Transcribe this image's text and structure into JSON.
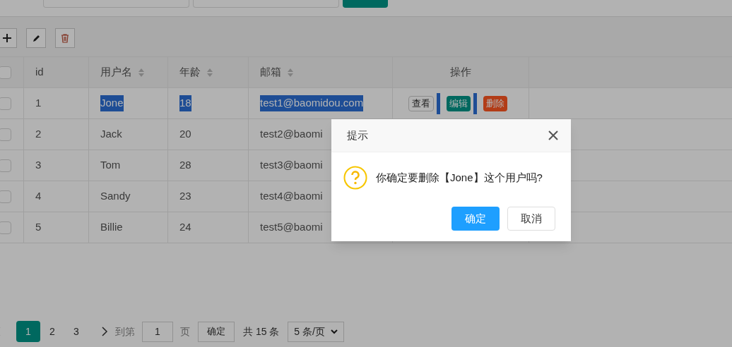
{
  "toolbar": {
    "buttons": [
      {
        "kind": "add"
      },
      {
        "kind": "edit"
      },
      {
        "kind": "delete"
      }
    ]
  },
  "table": {
    "all_checked": false,
    "columns": [
      {
        "label": "id",
        "sortable": false
      },
      {
        "label": "用户名",
        "sortable": true
      },
      {
        "label": "年龄",
        "sortable": true
      },
      {
        "label": "邮箱",
        "sortable": true
      },
      {
        "label": "操作",
        "sortable": false
      }
    ],
    "rows": [
      {
        "id": "1",
        "name": "Jone",
        "age": "18",
        "email": "test1@baomidou.com",
        "checked": false,
        "text_selected": true,
        "actions": [
          "查看",
          "编辑",
          "删除"
        ]
      },
      {
        "id": "2",
        "name": "Jack",
        "age": "20",
        "email": "test2@baomi",
        "checked": false,
        "text_selected": false
      },
      {
        "id": "3",
        "name": "Tom",
        "age": "28",
        "email": "test3@baomi",
        "checked": false,
        "text_selected": false
      },
      {
        "id": "4",
        "name": "Sandy",
        "age": "23",
        "email": "test4@baomi",
        "checked": false,
        "text_selected": false
      },
      {
        "id": "5",
        "name": "Billie",
        "age": "24",
        "email": "test5@baomi",
        "checked": false,
        "text_selected": false
      }
    ]
  },
  "pagination": {
    "pages": [
      {
        "label": "1",
        "selected": true
      },
      {
        "label": "2",
        "selected": false
      },
      {
        "label": "3",
        "selected": false
      }
    ],
    "goto_label": "到第",
    "goto_value": "1",
    "page_label": "页",
    "confirm": "确定",
    "total": "共 15 条",
    "page_size": "5 条/页"
  },
  "dialog": {
    "title": "提示",
    "message": "你确定要删除【Jone】这个用户吗?",
    "buttons": [
      {
        "label": "确定",
        "primary": true
      },
      {
        "label": "取消",
        "primary": false
      }
    ]
  }
}
